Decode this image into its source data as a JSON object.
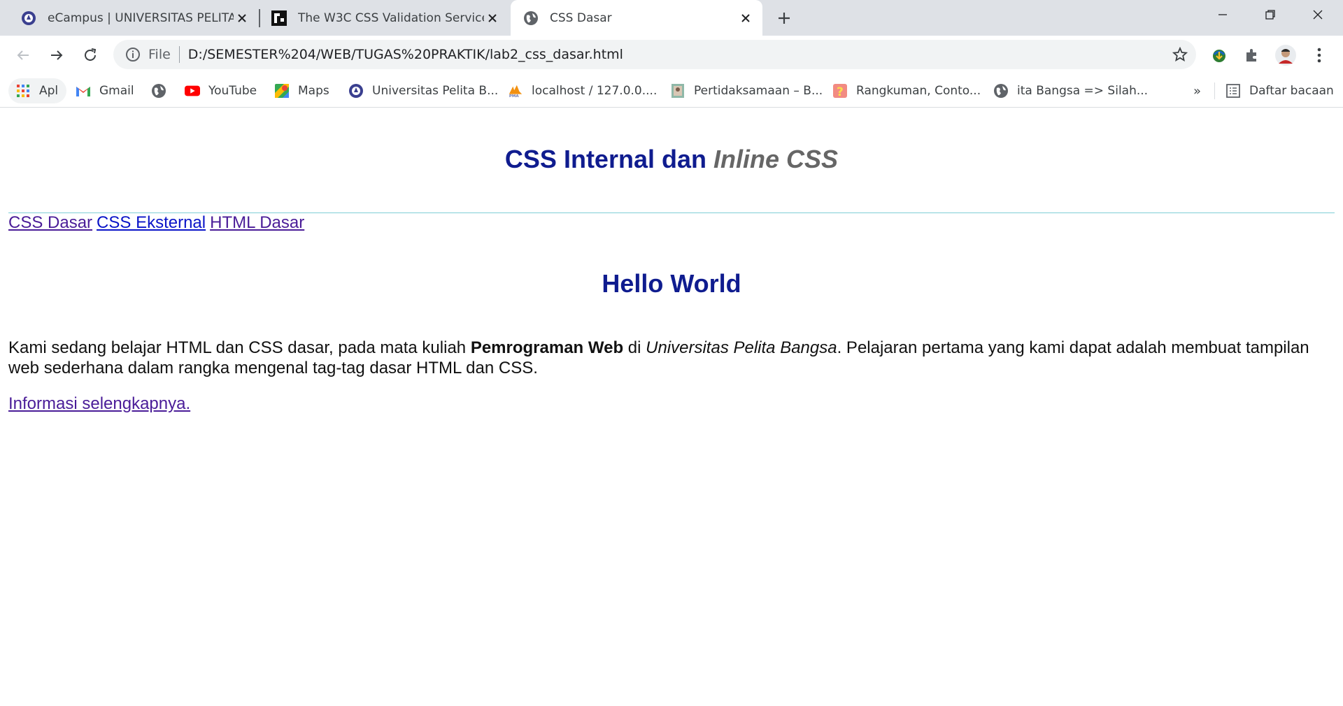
{
  "browser": {
    "tabs": [
      {
        "title": "eCampus | UNIVERSITAS PELITA BANGSA",
        "favicon": "university-logo-icon",
        "active": false
      },
      {
        "title": "The W3C CSS Validation Service",
        "favicon": "w3c-icon",
        "active": false
      },
      {
        "title": "CSS Dasar",
        "favicon": "globe-icon",
        "active": true
      }
    ],
    "address": {
      "scheme": "File",
      "url": "D:/SEMESTER%204/WEB/TUGAS%20PRAKTIK/lab2_css_dasar.html"
    },
    "bookmarks": [
      {
        "label": "Apl",
        "icon": "apps-grid-icon"
      },
      {
        "label": "Gmail",
        "icon": "gmail-icon"
      },
      {
        "label": "",
        "icon": "globe-icon"
      },
      {
        "label": "YouTube",
        "icon": "youtube-icon"
      },
      {
        "label": "Maps",
        "icon": "maps-icon"
      },
      {
        "label": "Universitas Pelita B...",
        "icon": "university-logo-icon"
      },
      {
        "label": "localhost / 127.0.0....",
        "icon": "phpmyadmin-icon"
      },
      {
        "label": "Pertidaksamaan – B...",
        "icon": "document-thumbnail-icon"
      },
      {
        "label": "Rangkuman, Conto...",
        "icon": "question-mark-icon"
      },
      {
        "label": "ita Bangsa => Silah...",
        "icon": "globe-icon"
      }
    ],
    "overflow_label": "»",
    "reading_list_label": "Daftar bacaan"
  },
  "page": {
    "title_main": "CSS Internal dan",
    "title_italic": "Inline",
    "title_tail": "CSS",
    "nav_links": [
      "CSS Dasar",
      "CSS Eksternal",
      "HTML Dasar"
    ],
    "heading": "Hello World",
    "paragraph": {
      "part1": "Kami sedang belajar HTML dan CSS dasar, pada mata kuliah ",
      "bold": "Pemrograman Web",
      "part2": " di ",
      "italic": "Universitas Pelita Bangsa",
      "part3": ". Pelajaran pertama yang kami dapat adalah membuat tampilan web sederhana dalam rangka mengenal tag-tag dasar HTML dan CSS."
    },
    "more_link": "Informasi selengkapnya."
  }
}
